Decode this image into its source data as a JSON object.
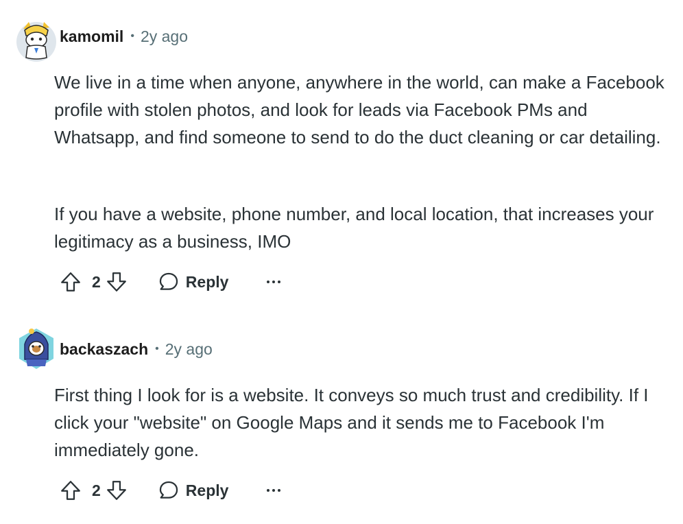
{
  "comments": [
    {
      "username": "kamomil",
      "separator": "•",
      "timestamp": "2y ago",
      "avatar_icon": "snoo-avatar-gold-hat-icon",
      "paragraphs": [
        "We live in a time when anyone, anywhere in the world, can make a Facebook profile with stolen photos, and look for leads via Facebook PMs and Whatsapp, and find someone to send to do the duct cleaning or car detailing.",
        "If you have a website, phone number, and local location, that increases your legitimacy as a business, IMO"
      ],
      "votes": "2",
      "reply_label": "Reply",
      "more_label": "···"
    },
    {
      "username": "backaszach",
      "separator": "•",
      "timestamp": "2y ago",
      "avatar_icon": "snoo-avatar-blue-hood-icon",
      "paragraphs": [
        "First thing I look for is a website. It conveys so much trust and credibility. If I click your \"website\" on Google Maps and it sends me to Facebook I'm immediately gone."
      ],
      "votes": "2",
      "reply_label": "Reply",
      "more_label": "···"
    }
  ],
  "colors": {
    "text": "#2a3236",
    "meta": "#576f76",
    "icon_stroke": "#2a3236"
  }
}
